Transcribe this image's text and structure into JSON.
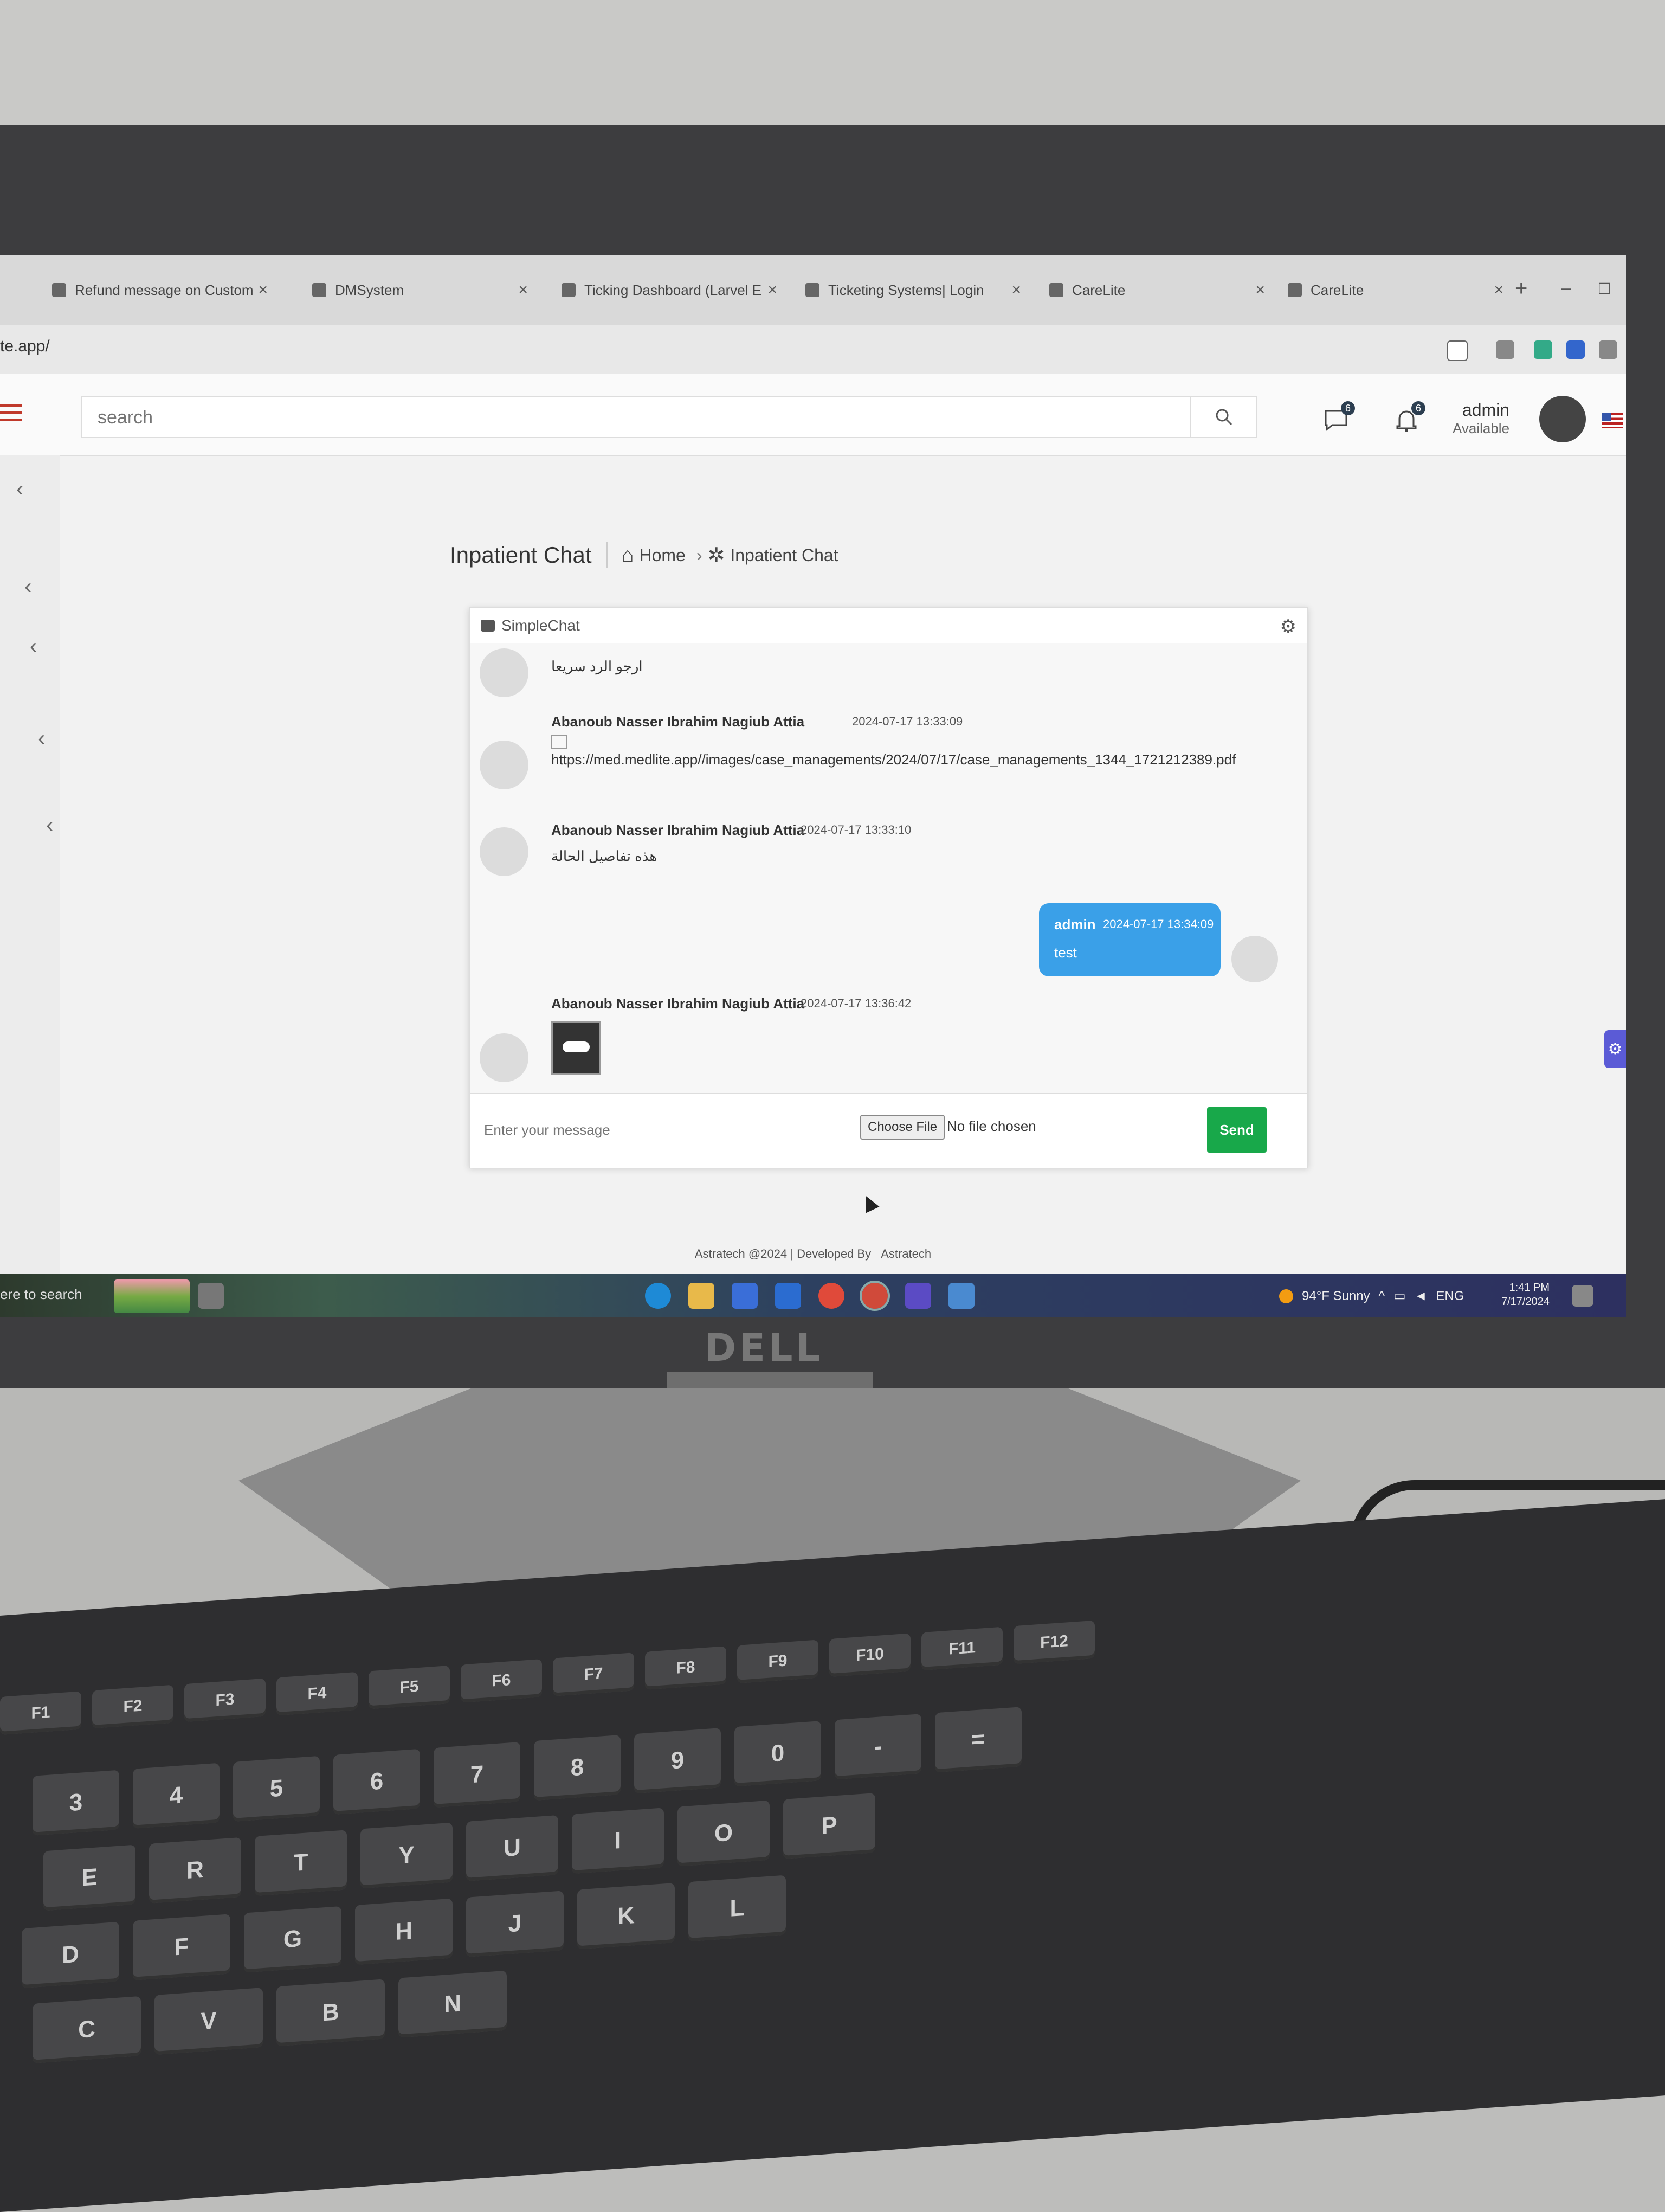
{
  "browser": {
    "tabs": [
      {
        "label": "Refund message on Customer"
      },
      {
        "label": "DMSystem"
      },
      {
        "label": "Ticking Dashboard (Larvel Er"
      },
      {
        "label": "Ticketing Systems| Login"
      },
      {
        "label": "CareLite"
      },
      {
        "label": "CareLite"
      }
    ],
    "new_tab": "+",
    "url": "te.app/"
  },
  "header": {
    "search_placeholder": "search",
    "messages_badge": "6",
    "notifications_badge": "6",
    "user_name": "admin",
    "user_status": "Available"
  },
  "page": {
    "title": "Inpatient Chat",
    "breadcrumb_home": "Home",
    "breadcrumb_current": "Inpatient Chat"
  },
  "chat": {
    "panel_title": "SimpleChat",
    "messages": [
      {
        "text": "ارجو الرد سريعا"
      },
      {
        "sender": "Abanoub Nasser Ibrahim Nagiub Attia",
        "time": "2024-07-17 13:33:09",
        "text": "https://med.medlite.app//images/case_managements/2024/07/17/case_managements_1344_1721212389.pdf"
      },
      {
        "sender": "Abanoub Nasser Ibrahim Nagiub Attia",
        "time": "2024-07-17 13:33:10",
        "text": "هذه تفاصيل الحالة"
      },
      {
        "sender": "admin",
        "time": "2024-07-17 13:34:09",
        "text": "test"
      },
      {
        "sender": "Abanoub Nasser Ibrahim Nagiub Attia",
        "time": "2024-07-17 13:36:42"
      }
    ],
    "input_placeholder": "Enter your message",
    "choose_file": "Choose File",
    "no_file": "No file chosen",
    "send": "Send"
  },
  "footer": {
    "copyright": "Astratech @2024 | Developed By",
    "developer": "Astratech"
  },
  "taskbar": {
    "search_text": "ere to search",
    "weather": "94°F  Sunny",
    "lang": "ENG",
    "time": "1:41 PM",
    "date": "7/17/2024"
  },
  "monitor": {
    "brand": "DELL"
  },
  "keyboard": {
    "fkeys": [
      "F1",
      "F2",
      "F3",
      "F4",
      "F5",
      "F6",
      "F7",
      "F8",
      "F9",
      "F10",
      "F11",
      "F12"
    ],
    "row1": [
      "3",
      "4",
      "5",
      "6",
      "7",
      "8",
      "9",
      "0",
      "-",
      "="
    ],
    "row2": [
      "E",
      "R",
      "T",
      "Y",
      "U",
      "I",
      "O",
      "P"
    ],
    "row3": [
      "D",
      "F",
      "G",
      "H",
      "J",
      "K",
      "L"
    ],
    "row4": [
      "C",
      "V",
      "B",
      "N"
    ]
  },
  "colors": {
    "send_button": "#18a84a",
    "own_message": "#3aa0e8",
    "accent_menu": "#c0392b"
  }
}
